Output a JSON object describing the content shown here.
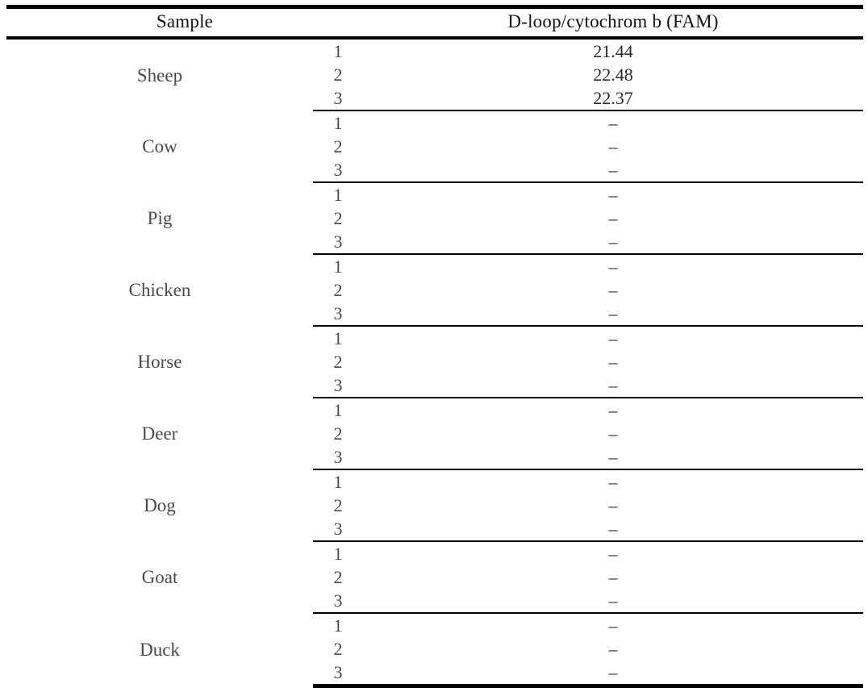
{
  "table": {
    "headers": {
      "sample": "Sample",
      "value": "D-loop/cytochrom b (FAM)"
    },
    "replicate_labels": [
      "1",
      "2",
      "3"
    ],
    "no_value_mark": "–",
    "groups": [
      {
        "sample": "Sheep",
        "rows": [
          {
            "replicate": "1",
            "value": "21.44"
          },
          {
            "replicate": "2",
            "value": "22.48"
          },
          {
            "replicate": "3",
            "value": "22.37"
          }
        ]
      },
      {
        "sample": "Cow",
        "rows": [
          {
            "replicate": "1",
            "value": "–"
          },
          {
            "replicate": "2",
            "value": "–"
          },
          {
            "replicate": "3",
            "value": "–"
          }
        ]
      },
      {
        "sample": "Pig",
        "rows": [
          {
            "replicate": "1",
            "value": "–"
          },
          {
            "replicate": "2",
            "value": "–"
          },
          {
            "replicate": "3",
            "value": "–"
          }
        ]
      },
      {
        "sample": "Chicken",
        "rows": [
          {
            "replicate": "1",
            "value": "–"
          },
          {
            "replicate": "2",
            "value": "–"
          },
          {
            "replicate": "3",
            "value": "–"
          }
        ]
      },
      {
        "sample": "Horse",
        "rows": [
          {
            "replicate": "1",
            "value": "–"
          },
          {
            "replicate": "2",
            "value": "–"
          },
          {
            "replicate": "3",
            "value": "–"
          }
        ]
      },
      {
        "sample": "Deer",
        "rows": [
          {
            "replicate": "1",
            "value": "–"
          },
          {
            "replicate": "2",
            "value": "–"
          },
          {
            "replicate": "3",
            "value": "–"
          }
        ]
      },
      {
        "sample": "Dog",
        "rows": [
          {
            "replicate": "1",
            "value": "–"
          },
          {
            "replicate": "2",
            "value": "–"
          },
          {
            "replicate": "3",
            "value": "–"
          }
        ]
      },
      {
        "sample": "Goat",
        "rows": [
          {
            "replicate": "1",
            "value": "–"
          },
          {
            "replicate": "2",
            "value": "–"
          },
          {
            "replicate": "3",
            "value": "–"
          }
        ]
      },
      {
        "sample": "Duck",
        "rows": [
          {
            "replicate": "1",
            "value": "–"
          },
          {
            "replicate": "2",
            "value": "–"
          },
          {
            "replicate": "3",
            "value": "–"
          }
        ]
      }
    ]
  }
}
